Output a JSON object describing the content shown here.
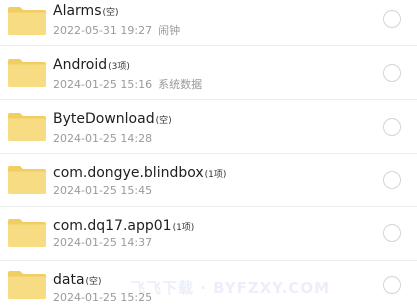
{
  "colors": {
    "folder_back": "#f2ce62",
    "folder_front": "#f7dc84",
    "text_primary": "#1e1e1e",
    "text_secondary": "#9a9a9a",
    "radio_border": "#d4d4d4"
  },
  "icons": {
    "folder": "folder-icon",
    "checkbox": "radio-circle"
  },
  "files": [
    {
      "name": "Alarms",
      "count": "(空)",
      "date": "2022-05-31 19:27",
      "desc": "闹钟"
    },
    {
      "name": "Android",
      "count": "(3项)",
      "date": "2024-01-25 15:16",
      "desc": "系统数据"
    },
    {
      "name": "ByteDownload",
      "count": "(空)",
      "date": "2024-01-25 14:28",
      "desc": ""
    },
    {
      "name": "com.dongye.blindbox",
      "count": "(1项)",
      "date": "2024-01-25 15:45",
      "desc": ""
    },
    {
      "name": "com.dq17.app01",
      "count": "(1项)",
      "date": "2024-01-25 14:37",
      "desc": ""
    },
    {
      "name": "data",
      "count": "(空)",
      "date": "2024-01-25 15:25",
      "desc": ""
    }
  ],
  "watermark": "飞飞下载 · BYFZXY.COM"
}
